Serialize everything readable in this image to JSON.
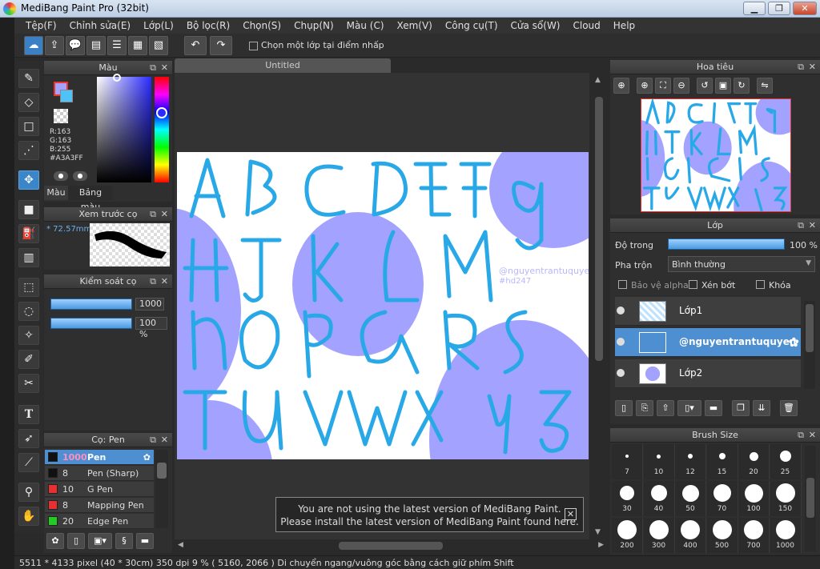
{
  "window": {
    "title": "MediBang Paint Pro (32bit)",
    "min": "▁",
    "max": "❐",
    "close": "✕"
  },
  "menu": [
    "Tệp(F)",
    "Chỉnh sửa(E)",
    "Lớp(L)",
    "Bộ lọc(R)",
    "Chọn(S)",
    "Chụp(N)",
    "Màu (C)",
    "Xem(V)",
    "Công cụ(T)",
    "Cửa sổ(W)",
    "Cloud",
    "Help"
  ],
  "toolbar": {
    "checkbox_label": "Chọn một lớp tại điểm nhấp"
  },
  "color_panel": {
    "title": "Màu",
    "r": "R:163",
    "g": "G:163",
    "b": "B:255",
    "hex": "#A3A3FF",
    "tab_color": "Màu",
    "tab_palette": "Bảng màu",
    "fg_color": "#A3A3FF",
    "bg_color": "#4FC3F7"
  },
  "preview_panel": {
    "title": "Xem trước cọ",
    "size": "* 72.57mm"
  },
  "brush_control": {
    "title": "Kiểm soát cọ",
    "size_value": "1000",
    "opacity_value": "100 %"
  },
  "brush_panel": {
    "title": "Cọ: Pen",
    "items": [
      {
        "size": "1000",
        "name": "Pen",
        "color": "#111111"
      },
      {
        "size": "8",
        "name": "Pen (Sharp)",
        "color": "#111111"
      },
      {
        "size": "10",
        "name": "G Pen",
        "color": "#e83030"
      },
      {
        "size": "8",
        "name": "Mapping Pen",
        "color": "#e83030"
      },
      {
        "size": "20",
        "name": "Edge Pen",
        "color": "#22cc22"
      }
    ]
  },
  "document": {
    "tab": "Untitled",
    "watermark_line1": "@nguyentrantuquyen",
    "watermark_line2": "#hd247"
  },
  "notice": {
    "line1": "You are not using the latest version of MediBang Paint.",
    "line2": "Please install the latest version of MediBang Paint found here."
  },
  "status_bar": "5511 * 4133 pixel  (40 * 30cm)  350 dpi  9 %  ( 5160, 2066 )  Di chuyển ngang/vuông góc bằng cách giữ phím Shift",
  "navigator": {
    "title": "Hoa tiêu"
  },
  "layers_panel": {
    "title": "Lớp",
    "opacity_label": "Độ trong",
    "opacity_value": "100 %",
    "blend_label": "Pha trộn",
    "blend_value": "Bình thường",
    "protect_alpha": "Bảo vệ alpha",
    "clipping": "Xén bớt",
    "lock": "Khóa",
    "layers": [
      {
        "name": "Lớp1"
      },
      {
        "name": "@nguyentrantuquyen"
      },
      {
        "name": "Lớp2"
      }
    ]
  },
  "brush_size": {
    "title": "Brush Size",
    "sizes": [
      "7",
      "10",
      "12",
      "15",
      "20",
      "25",
      "30",
      "40",
      "50",
      "70",
      "100",
      "150",
      "200",
      "300",
      "400",
      "500",
      "700",
      "1000"
    ]
  },
  "colors": {
    "accent": "#4d8fd0",
    "lavender": "#A3A3FF",
    "stroke_blue": "#29a8e8"
  }
}
